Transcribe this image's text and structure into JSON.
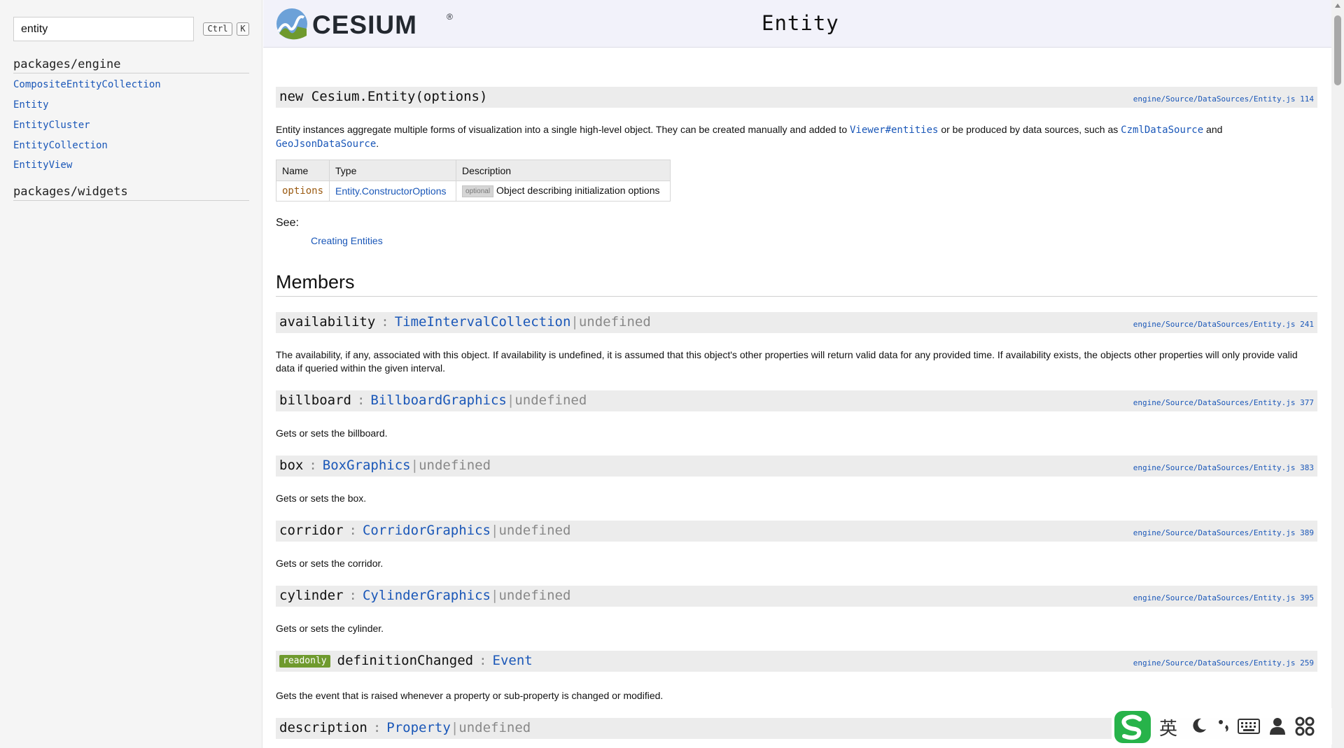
{
  "sidebar": {
    "search_value": "entity",
    "shortcut": [
      "Ctrl",
      "K"
    ],
    "groups": [
      {
        "label": "packages/engine",
        "items": [
          "CompositeEntityCollection",
          "Entity",
          "EntityCluster",
          "EntityCollection",
          "EntityView"
        ]
      },
      {
        "label": "packages/widgets",
        "items": []
      }
    ]
  },
  "header": {
    "logo_text": "CESIUM",
    "logo_reg": "®",
    "title": "Entity"
  },
  "constructor": {
    "signature": "new Cesium.Entity(options)",
    "source": "engine/Source/DataSources/Entity.js 114",
    "desc": {
      "part1": "Entity instances aggregate multiple forms of visualization into a single high-level object. They can be created manually and added to ",
      "link1": "Viewer#entities",
      "part2": " or be produced by data sources, such as ",
      "link2": "CzmlDataSource",
      "part3": " and",
      "link3": "GeoJsonDataSource",
      "part4": "."
    },
    "table": {
      "headers": [
        "Name",
        "Type",
        "Description"
      ],
      "row": {
        "name": "options",
        "type": "Entity.ConstructorOptions",
        "badge": "optional",
        "description": "Object describing initialization options"
      }
    },
    "see_label": "See:",
    "see_link": "Creating Entities"
  },
  "members_heading": "Members",
  "members": [
    {
      "name": "availability",
      "type": "TimeIntervalCollection",
      "alt": "undefined",
      "source": "engine/Source/DataSources/Entity.js 241",
      "desc": "The availability, if any, associated with this object. If availability is undefined, it is assumed that this object's other properties will return valid data for any provided time. If availability exists, the objects other properties will only provide valid data if queried within the given interval."
    },
    {
      "name": "billboard",
      "type": "BillboardGraphics",
      "alt": "undefined",
      "source": "engine/Source/DataSources/Entity.js 377",
      "desc": "Gets or sets the billboard."
    },
    {
      "name": "box",
      "type": "BoxGraphics",
      "alt": "undefined",
      "source": "engine/Source/DataSources/Entity.js 383",
      "desc": "Gets or sets the box."
    },
    {
      "name": "corridor",
      "type": "CorridorGraphics",
      "alt": "undefined",
      "source": "engine/Source/DataSources/Entity.js 389",
      "desc": "Gets or sets the corridor."
    },
    {
      "name": "cylinder",
      "type": "CylinderGraphics",
      "alt": "undefined",
      "source": "engine/Source/DataSources/Entity.js 395",
      "desc": "Gets or sets the cylinder."
    },
    {
      "badge": "readonly",
      "name": "definitionChanged",
      "type": "Event",
      "source": "engine/Source/DataSources/Entity.js 259",
      "desc": "Gets the event that is raised whenever a property or sub-property is changed or modified."
    },
    {
      "name": "description",
      "type": "Property",
      "alt": "undefined"
    }
  ],
  "ime": {
    "lang": "英",
    "items": [
      "moon-icon",
      "punctuation-icon",
      "keyboard-icon",
      "user-icon",
      "grid-icon"
    ]
  },
  "colors": {
    "link": "#1a57b8",
    "badge_green": "#6f9a2e",
    "param_name": "#9b5b12"
  }
}
